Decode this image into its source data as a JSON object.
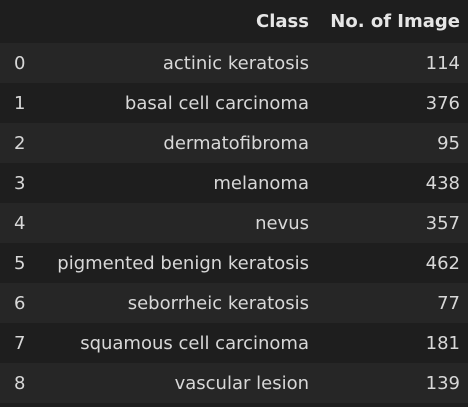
{
  "table": {
    "headers": {
      "index": "",
      "class": "Class",
      "count": "No. of Image"
    },
    "rows": [
      {
        "index": "0",
        "class": "actinic keratosis",
        "count": "114"
      },
      {
        "index": "1",
        "class": "basal cell carcinoma",
        "count": "376"
      },
      {
        "index": "2",
        "class": "dermatofibroma",
        "count": "95"
      },
      {
        "index": "3",
        "class": "melanoma",
        "count": "438"
      },
      {
        "index": "4",
        "class": "nevus",
        "count": "357"
      },
      {
        "index": "5",
        "class": "pigmented benign keratosis",
        "count": "462"
      },
      {
        "index": "6",
        "class": "seborrheic keratosis",
        "count": "77"
      },
      {
        "index": "7",
        "class": "squamous cell carcinoma",
        "count": "181"
      },
      {
        "index": "8",
        "class": "vascular lesion",
        "count": "139"
      }
    ]
  }
}
